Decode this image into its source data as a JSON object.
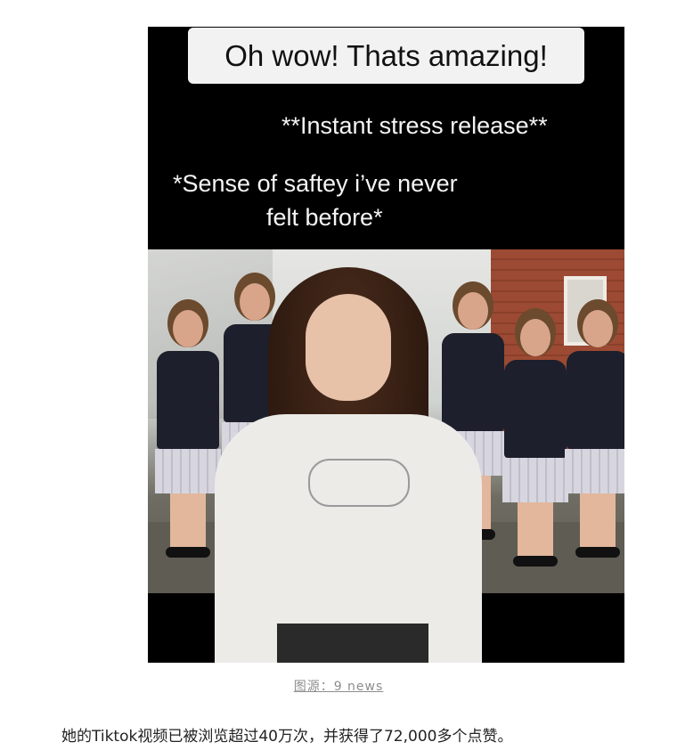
{
  "video": {
    "caption_box": "Oh wow! Thats amazing!",
    "overlay_lines": [
      "**Instant stress release**",
      "*Sense of saftey i’ve never",
      "felt before*"
    ]
  },
  "image_source": "图源：9 news",
  "paragraph": "她的Tiktok视频已被浏览超过40万次，并获得了72,000多个点赞。"
}
